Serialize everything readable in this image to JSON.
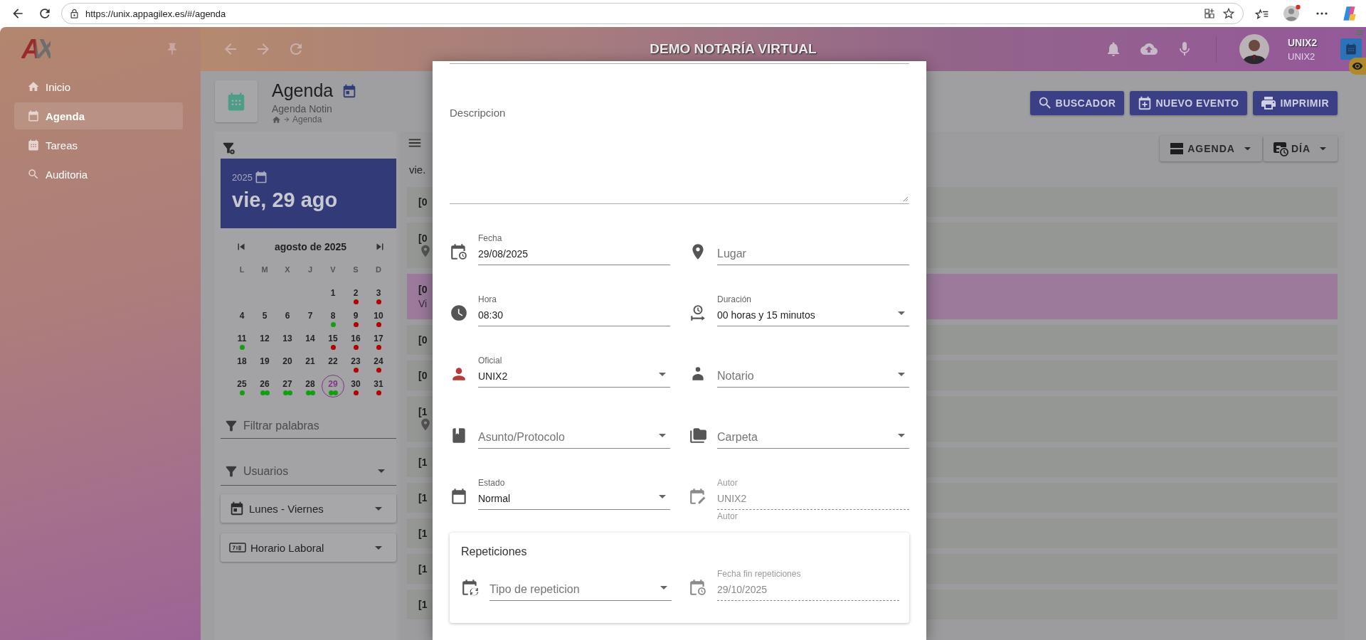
{
  "browser": {
    "url": "https://unix.appagilex.es/#/agenda"
  },
  "app": {
    "logo": "AX",
    "title": "DEMO NOTARÍA VIRTUAL",
    "user_name": "UNIX2",
    "user_role": "UNIX2"
  },
  "sidebar": {
    "items": [
      {
        "label": "Inicio",
        "selected": false
      },
      {
        "label": "Agenda",
        "selected": true
      },
      {
        "label": "Tareas",
        "selected": false
      },
      {
        "label": "Auditoria",
        "selected": false
      }
    ]
  },
  "page": {
    "title": "Agenda",
    "subtitle": "Agenda Notin",
    "breadcrumb": "Agenda"
  },
  "actions": [
    {
      "label": "BUSCADOR",
      "kind": "search"
    },
    {
      "label": "NUEVO EVENTO",
      "kind": "add"
    },
    {
      "label": "IMPRIMIR",
      "kind": "print"
    }
  ],
  "calendar": {
    "year": "2025",
    "date": "vie, 29 ago",
    "month": "agosto de 2025",
    "weekdays": [
      "L",
      "M",
      "X",
      "J",
      "V",
      "S",
      "D"
    ],
    "weeks": [
      [
        {
          "day": "1",
          "selected": false
        },
        {
          "day": "2",
          "selected": false,
          "events": [
            {
              "color": "#b00000"
            }
          ]
        },
        {
          "day": "3",
          "selected": false,
          "events": [
            {
              "color": "#b00000"
            }
          ]
        }
      ],
      [
        {
          "day": "4",
          "selected": false
        },
        {
          "day": "5",
          "selected": false
        },
        {
          "day": "6",
          "selected": false
        },
        {
          "day": "7",
          "selected": false
        },
        {
          "day": "8",
          "selected": false,
          "events": [
            {
              "color": "#10a010"
            }
          ]
        },
        {
          "day": "9",
          "selected": false,
          "events": [
            {
              "color": "#b00000"
            }
          ]
        },
        {
          "day": "10",
          "selected": false,
          "events": [
            {
              "color": "#b00000"
            }
          ]
        }
      ],
      [
        {
          "day": "11",
          "selected": false,
          "events": [
            {
              "color": "#10a010"
            }
          ]
        },
        {
          "day": "12",
          "selected": false
        },
        {
          "day": "13",
          "selected": false
        },
        {
          "day": "14",
          "selected": false
        },
        {
          "day": "15",
          "selected": false,
          "events": [
            {
              "color": "#b00000"
            }
          ]
        },
        {
          "day": "16",
          "selected": false,
          "events": [
            {
              "color": "#b00000"
            }
          ]
        },
        {
          "day": "17",
          "selected": false,
          "events": [
            {
              "color": "#b00000"
            }
          ]
        }
      ],
      [
        {
          "day": "18",
          "selected": false
        },
        {
          "day": "19",
          "selected": false
        },
        {
          "day": "20",
          "selected": false
        },
        {
          "day": "21",
          "selected": false
        },
        {
          "day": "22",
          "selected": false
        },
        {
          "day": "23",
          "selected": false,
          "events": [
            {
              "color": "#b00000"
            }
          ]
        },
        {
          "day": "24",
          "selected": false,
          "events": [
            {
              "color": "#b00000"
            }
          ]
        }
      ],
      [
        {
          "day": "25",
          "selected": false,
          "events": [
            {
              "color": "#10a010"
            }
          ]
        },
        {
          "day": "26",
          "selected": false,
          "events": [
            {
              "color": "#10a010"
            },
            {
              "color": "#10a010"
            }
          ]
        },
        {
          "day": "27",
          "selected": false,
          "events": [
            {
              "color": "#10a010"
            },
            {
              "color": "#10a010"
            }
          ]
        },
        {
          "day": "28",
          "selected": false,
          "events": [
            {
              "color": "#10a010"
            },
            {
              "color": "#10a010"
            }
          ]
        },
        {
          "day": "29",
          "selected": true,
          "events": [
            {
              "color": "#10a010"
            },
            {
              "color": "#10a010"
            }
          ]
        },
        {
          "day": "30",
          "selected": false,
          "events": [
            {
              "color": "#b00000"
            }
          ]
        },
        {
          "day": "31",
          "selected": false,
          "events": [
            {
              "color": "#b00000"
            }
          ]
        }
      ]
    ]
  },
  "filters": {
    "words": {
      "placeholder": "Filtrar palabras"
    },
    "users": {
      "placeholder": "Usuarios"
    },
    "days": "Lunes - Viernes",
    "hours": "Horario Laboral"
  },
  "agenda": {
    "views": [
      {
        "label": "AGENDA",
        "kind": "agenda"
      },
      {
        "label": "DÍA",
        "kind": "day"
      }
    ],
    "day_label": "vie.",
    "rows": [
      {
        "time": "[0",
        "selected": false,
        "kind": "plain"
      },
      {
        "time": "[0",
        "selected": false,
        "kind": "place"
      },
      {
        "time": "[0",
        "selected": true,
        "kind": "text",
        "text": "Vi"
      },
      {
        "time": "[0",
        "selected": false,
        "kind": "plain"
      },
      {
        "time": "[0",
        "selected": false,
        "kind": "plain"
      },
      {
        "time": "[1",
        "selected": false,
        "kind": "place"
      },
      {
        "time": "[1",
        "selected": false,
        "kind": "plain"
      },
      {
        "time": "[1",
        "selected": false,
        "kind": "plain"
      },
      {
        "time": "[1",
        "selected": false,
        "kind": "plain"
      },
      {
        "time": "[1",
        "selected": false,
        "kind": "plain"
      },
      {
        "time": "[1",
        "selected": false,
        "kind": "plain"
      }
    ]
  },
  "dialog": {
    "description": {
      "label": "Descripcion"
    },
    "fields": [
      {
        "kind": "input",
        "label": "Fecha",
        "value": "29/08/2025",
        "disabled": false
      },
      {
        "kind": "input",
        "placeholder": "Lugar",
        "disabled": false
      },
      {
        "kind": "input",
        "label": "Hora",
        "value": "08:30",
        "disabled": false
      },
      {
        "kind": "select",
        "label": "Duración",
        "value": "00 horas y 15 minutos",
        "disabled": false
      },
      {
        "kind": "select",
        "label": "Oficial",
        "value": "UNIX2",
        "disabled": false
      },
      {
        "kind": "select",
        "placeholder": "Notario",
        "disabled": false
      },
      {
        "kind": "select",
        "placeholder": "Asunto/Protocolo",
        "disabled": false
      },
      {
        "kind": "select",
        "placeholder": "Carpeta",
        "disabled": false
      },
      {
        "kind": "select",
        "label": "Estado",
        "value": "Normal",
        "disabled": false
      },
      {
        "kind": "input",
        "label": "Autor",
        "value": "UNIX2",
        "helper": "Autor",
        "disabled": true
      }
    ],
    "repetitions": {
      "title": "Repeticiones",
      "fields": [
        {
          "kind": "select",
          "placeholder": "Tipo de repeticion",
          "disabled": false
        },
        {
          "kind": "input",
          "label": "Fecha fin repeticiones",
          "value": "29/10/2025",
          "disabled": true
        }
      ]
    }
  }
}
